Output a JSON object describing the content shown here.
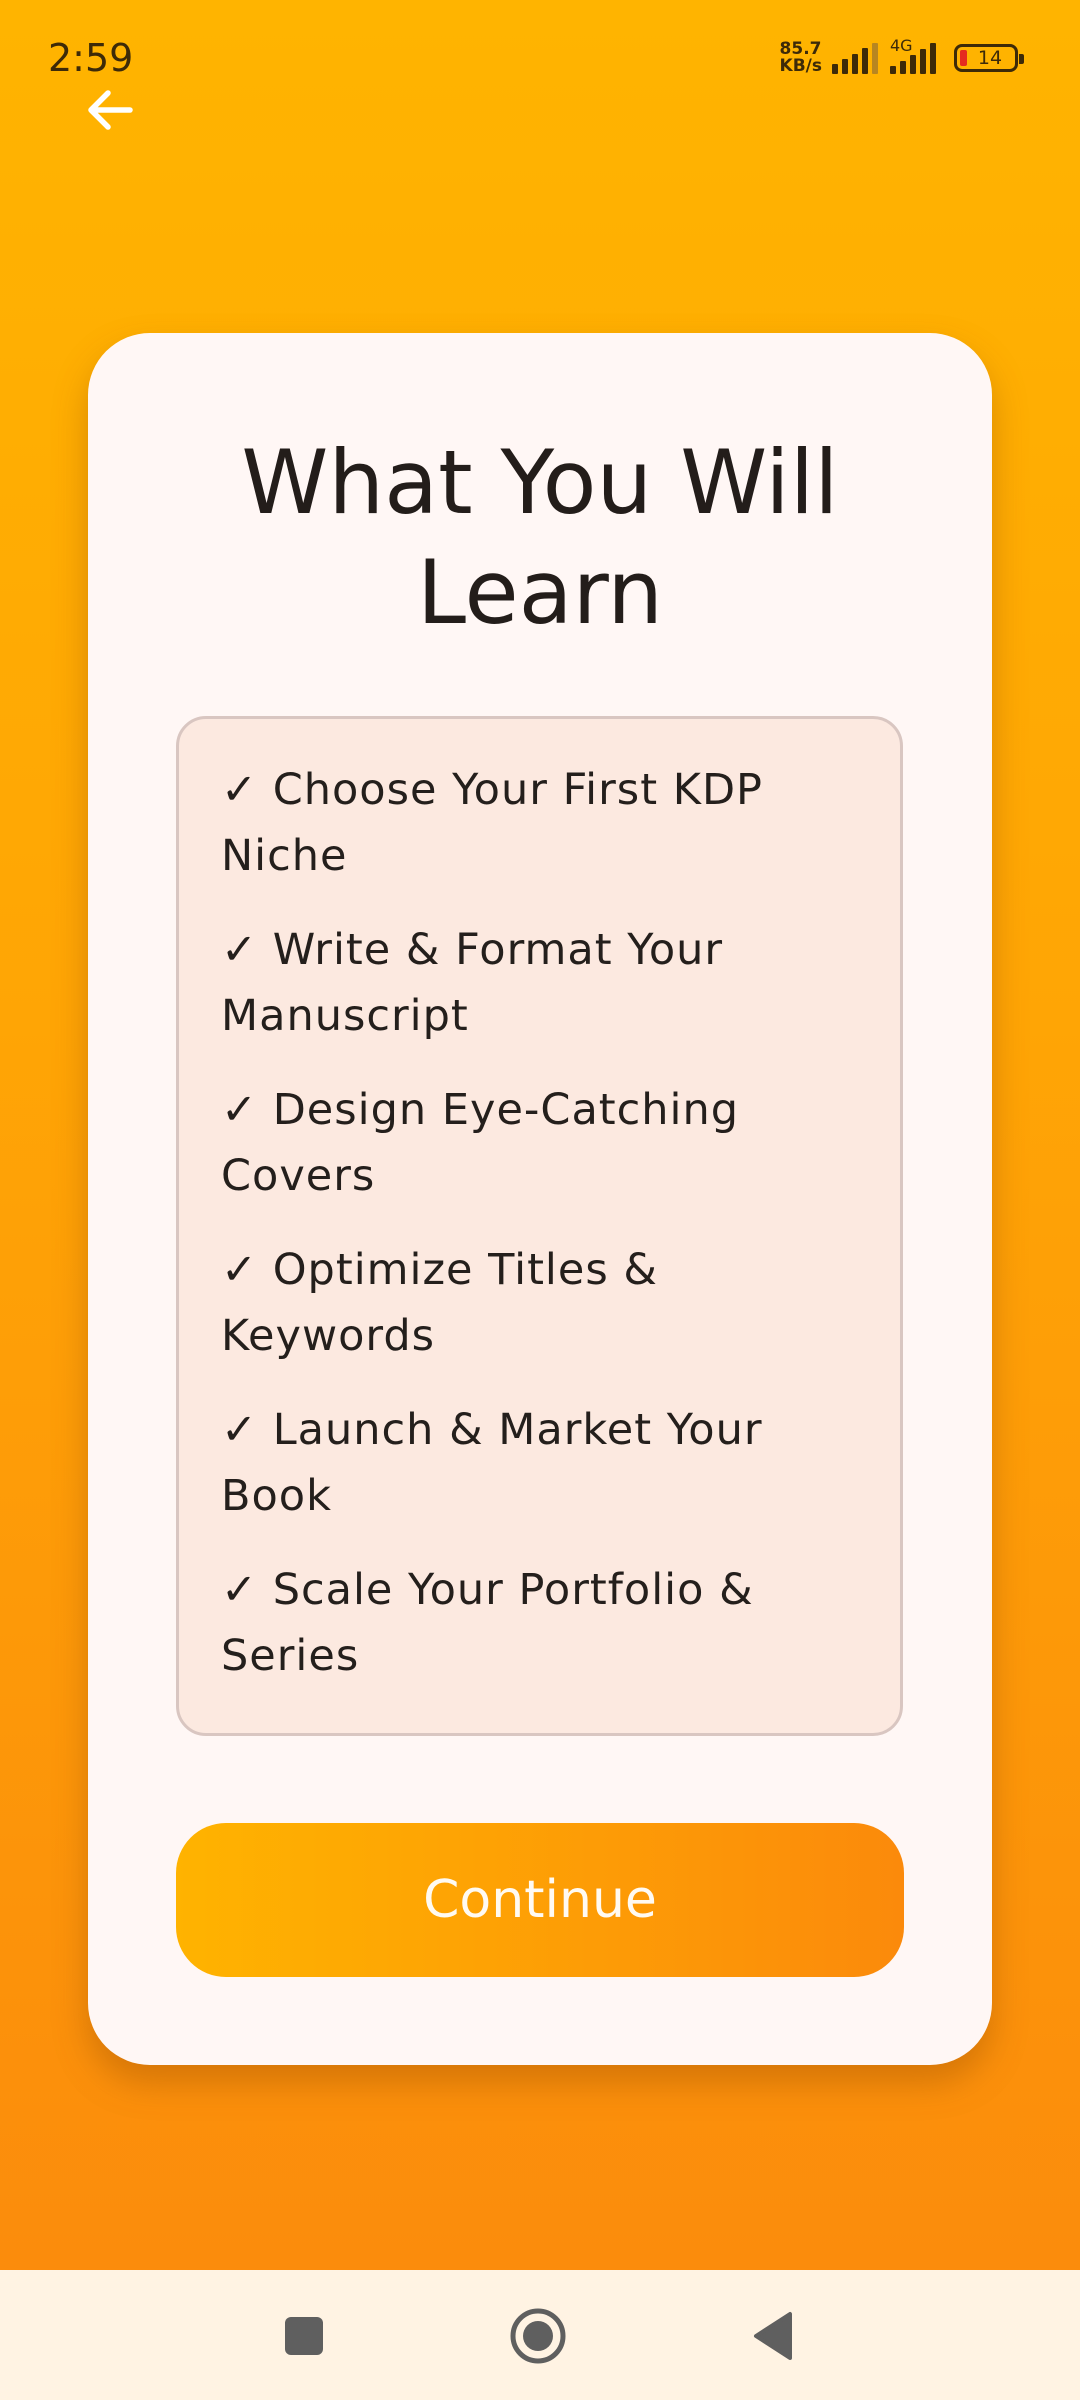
{
  "status_bar": {
    "time": "2:59",
    "net_speed_value": "85.7",
    "net_speed_unit": "KB/s",
    "network_type": "4G",
    "battery_level": "14"
  },
  "card": {
    "title": "What You Will Learn",
    "items": [
      {
        "label": "✓ Choose Your First KDP Niche"
      },
      {
        "label": "✓ Write & Format Your Manuscript"
      },
      {
        "label": "✓ Design Eye-Catching Covers"
      },
      {
        "label": "✓ Optimize Titles & Keywords"
      },
      {
        "label": "✓ Launch & Market Your Book"
      },
      {
        "label": "✓ Scale Your Portfolio & Series"
      }
    ],
    "continue_label": "Continue"
  },
  "icons": {
    "back": "arrow-left-icon",
    "nav_recents": "square-icon",
    "nav_home": "circle-icon",
    "nav_back": "triangle-left-icon"
  },
  "colors": {
    "background_top": "#ffb400",
    "background_bottom": "#fb8c0c",
    "card": "#fff7f5",
    "list_box": "#fce9e0",
    "button": "#fd9b06",
    "battery_low": "#e52b1f"
  }
}
